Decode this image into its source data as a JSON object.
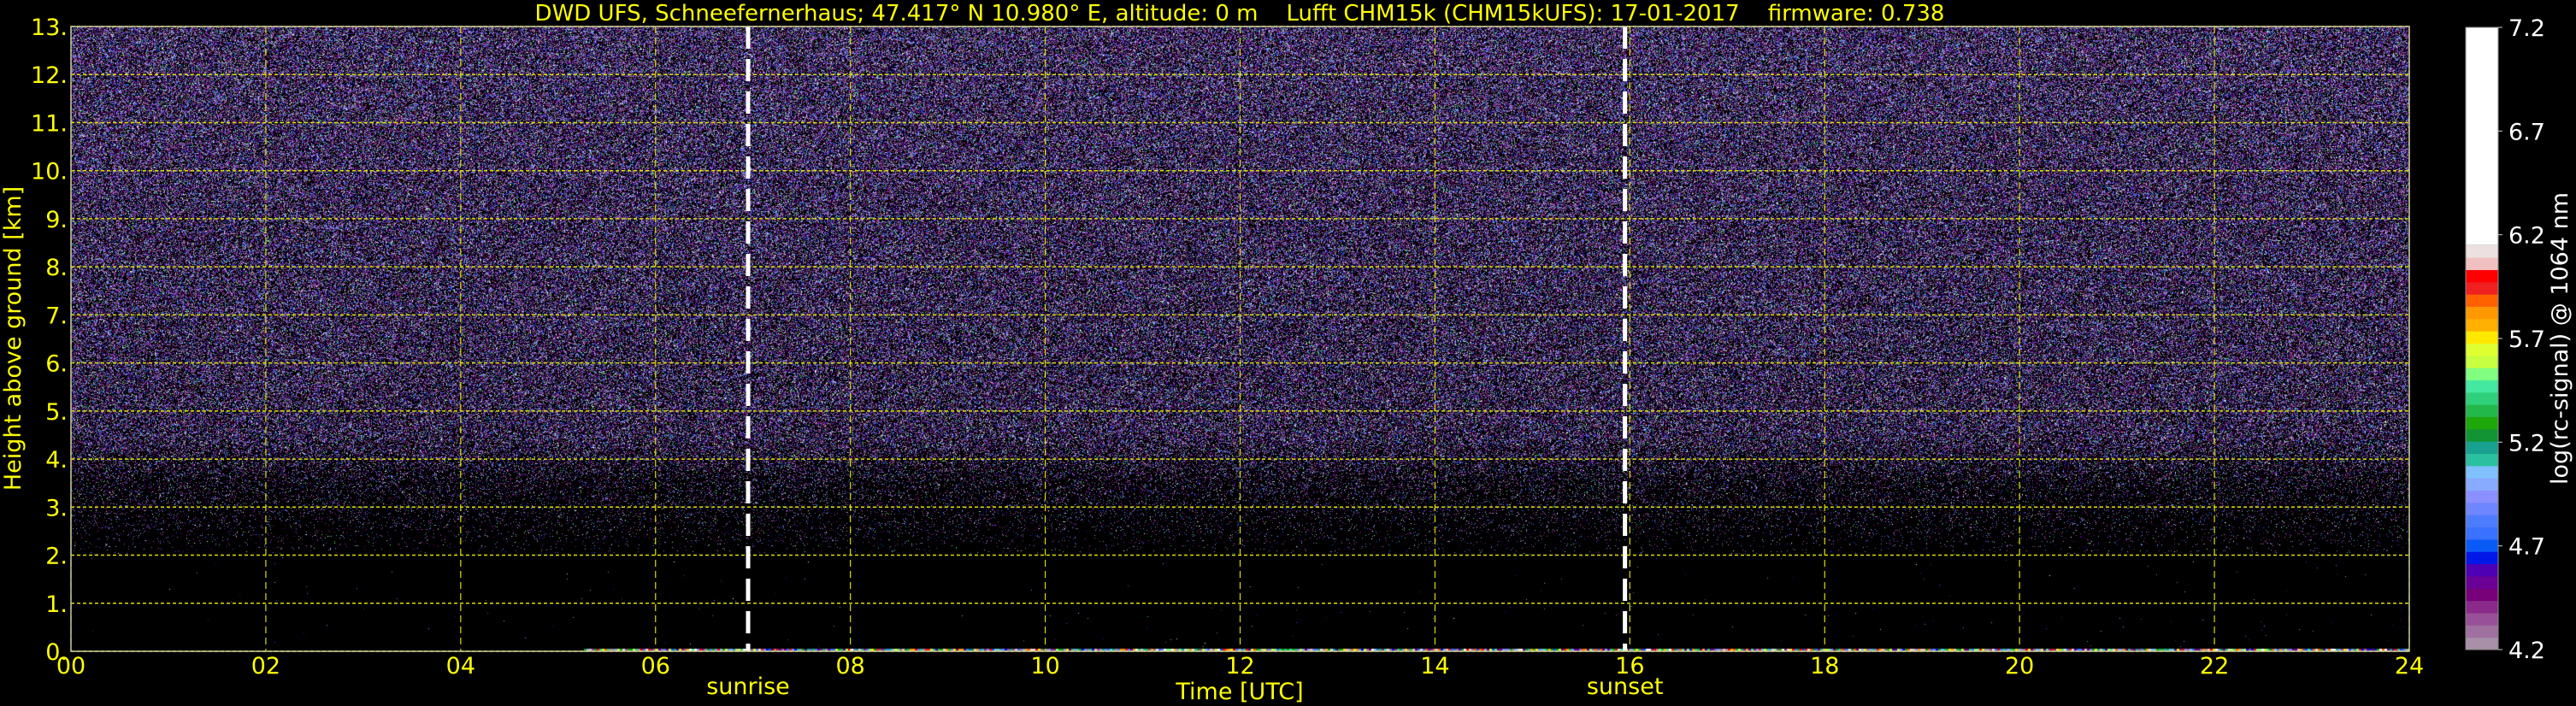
{
  "chart_data": {
    "type": "heatmap",
    "title": "DWD UFS, Schneefernerhaus; 47.417° N 10.980° E, altitude: 0 m    Lufft CHM15k (CHM15kUFS): 17-01-2017    firmware: 0.738",
    "xlabel": "Time [UTC]",
    "ylabel": "Height above ground [km]",
    "xlim": [
      0,
      24
    ],
    "ylim": [
      0,
      13
    ],
    "xticks": [
      "00",
      "02",
      "04",
      "06",
      "08",
      "10",
      "12",
      "14",
      "16",
      "18",
      "20",
      "22",
      "24"
    ],
    "yticks": [
      "0.",
      "1.",
      "2.",
      "3.",
      "4.",
      "5.",
      "6.",
      "7.",
      "8.",
      "9.",
      "10.",
      "11.",
      "12.",
      "13."
    ],
    "grid": true,
    "annotations": [
      {
        "label": "sunrise",
        "x": 6.95
      },
      {
        "label": "sunset",
        "x": 15.95
      }
    ],
    "colorbar": {
      "label": "log(rc-signal) @ 1064 nm",
      "range": [
        4.2,
        7.2
      ],
      "ticks": [
        "4.2",
        "4.7",
        "5.2",
        "5.7",
        "6.2",
        "6.7",
        "7.2"
      ],
      "colors": [
        "#a890a8",
        "#a070a0",
        "#985098",
        "#8a2a8a",
        "#780078",
        "#6a0096",
        "#4e00b4",
        "#0018e8",
        "#0a5af8",
        "#3a72ff",
        "#4e7cff",
        "#6e86ff",
        "#8a90ff",
        "#88aaff",
        "#80c0ff",
        "#2ac0a0",
        "#18a090",
        "#129434",
        "#1ea80a",
        "#22b84a",
        "#2ed07a",
        "#44e8a0",
        "#80ff80",
        "#c8ff40",
        "#e0ff30",
        "#ffe800",
        "#ffb000",
        "#ff9800",
        "#ff6000",
        "#f02020",
        "#ff0000",
        "#f0c0c0",
        "#ece0e0",
        "#ffffff"
      ]
    },
    "signal_description_levels_km": {
      "dense_above": 3.5,
      "sparse_between": [
        2.0,
        3.5
      ],
      "empty_below": 2.0
    }
  }
}
